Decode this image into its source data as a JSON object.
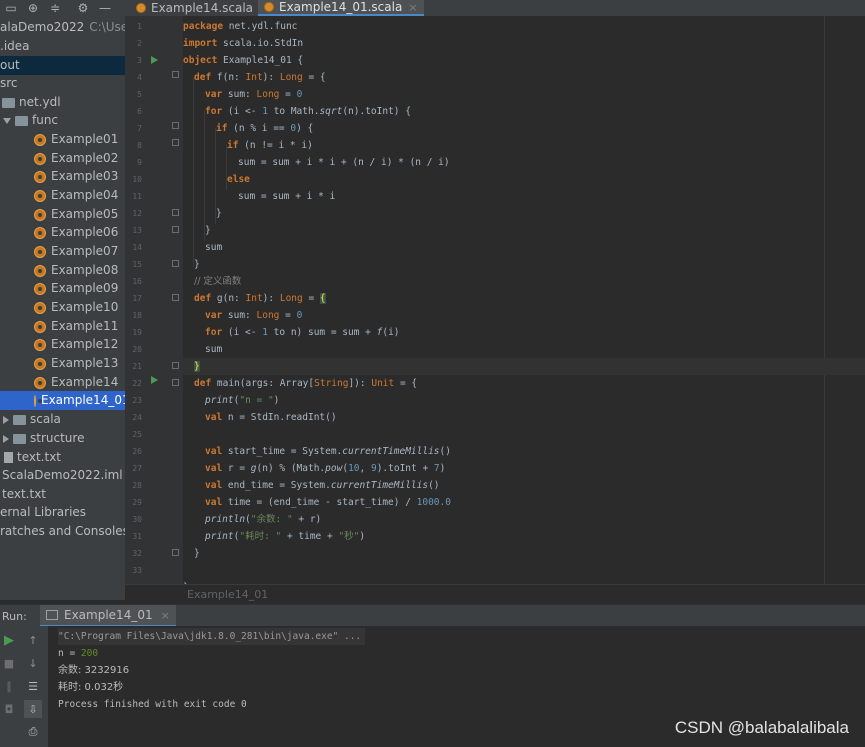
{
  "tabs": [
    {
      "label": "Example14.scala",
      "close": "×"
    },
    {
      "label": "Example14_01.scala",
      "close": "×"
    }
  ],
  "project_tree": [
    {
      "label": "alaDemo2022",
      "extra": "C:\\Users\\",
      "type": "folder-blue"
    },
    {
      "label": ".idea",
      "type": "folder"
    },
    {
      "label": "out",
      "type": "folder-orange",
      "selected": true
    },
    {
      "label": "src",
      "type": "folder-blue"
    },
    {
      "label": "net.ydl",
      "type": "folder"
    },
    {
      "label": "func",
      "type": "folder",
      "expanded": true
    },
    {
      "label": "Example01",
      "type": "scala"
    },
    {
      "label": "Example02",
      "type": "scala"
    },
    {
      "label": "Example03",
      "type": "scala"
    },
    {
      "label": "Example04",
      "type": "scala"
    },
    {
      "label": "Example05",
      "type": "scala"
    },
    {
      "label": "Example06",
      "type": "scala"
    },
    {
      "label": "Example07",
      "type": "scala"
    },
    {
      "label": "Example08",
      "type": "scala"
    },
    {
      "label": "Example09",
      "type": "scala"
    },
    {
      "label": "Example10",
      "type": "scala"
    },
    {
      "label": "Example11",
      "type": "scala"
    },
    {
      "label": "Example12",
      "type": "scala"
    },
    {
      "label": "Example13",
      "type": "scala"
    },
    {
      "label": "Example14",
      "type": "scala"
    },
    {
      "label": "Example14_01",
      "type": "scala",
      "active": true
    },
    {
      "label": "scala",
      "type": "folder"
    },
    {
      "label": "structure",
      "type": "folder"
    },
    {
      "label": "text.txt",
      "type": "file"
    },
    {
      "label": "ScalaDemo2022.iml",
      "type": "file"
    },
    {
      "label": "text.txt",
      "type": "file"
    },
    {
      "label": "ernal Libraries",
      "type": "lib"
    },
    {
      "label": "ratches and Consoles",
      "type": "lib"
    }
  ],
  "line_numbers": [
    "1",
    "2",
    "3",
    "4",
    "5",
    "6",
    "7",
    "8",
    "9",
    "10",
    "11",
    "12",
    "13",
    "14",
    "15",
    "16",
    "17",
    "18",
    "19",
    "20",
    "21",
    "22",
    "23",
    "24",
    "25",
    "26",
    "27",
    "28",
    "29",
    "30",
    "31",
    "32",
    "33"
  ],
  "code": {
    "l1": [
      "package",
      " net.ydl.func"
    ],
    "l2": [
      "import",
      " scala.io.StdIn"
    ],
    "l3": [
      "object",
      " Example14_01 {"
    ],
    "l4": [
      "def",
      " f(n: ",
      "Int",
      "): ",
      "Long",
      " = {"
    ],
    "l5": [
      "var",
      " sum: ",
      "Long",
      " = ",
      "0"
    ],
    "l6": [
      "for",
      " (i <- ",
      "1",
      " to Math.",
      "sqrt",
      "(n).toInt) {"
    ],
    "l7": [
      "if",
      " (n % i == ",
      "0",
      ") {"
    ],
    "l8": [
      "if",
      " (n != i * i)"
    ],
    "l9": "sum = sum + i * i + (n / i) * (n / i)",
    "l10": "else",
    "l11": "sum = sum + i * i",
    "l12": "}",
    "l13": "}",
    "l14": "sum",
    "l15": "}",
    "l16": "// 定义函数",
    "l17": [
      "def",
      " g(n: ",
      "Int",
      "): ",
      "Long",
      " = ",
      "{"
    ],
    "l18": [
      "var",
      " sum: ",
      "Long",
      " = ",
      "0"
    ],
    "l19": [
      "for",
      " (i <- ",
      "1",
      " to n) sum = sum + ",
      "f",
      "(i)"
    ],
    "l20": "sum",
    "l21": "}",
    "l22": [
      "def",
      " main(args: Array[",
      "String",
      "]): ",
      "Unit",
      " = {"
    ],
    "l23": [
      "print",
      "(",
      "\"n = \"",
      ")"
    ],
    "l24": [
      "val",
      " n = StdIn.",
      "readInt",
      "()"
    ],
    "l26": [
      "val",
      " start_time = System.",
      "currentTimeMillis",
      "()"
    ],
    "l27": [
      "val",
      " r = ",
      "g",
      "(n) % (Math.",
      "pow",
      "(",
      "10",
      ", ",
      "9",
      ").toInt + ",
      "7",
      ")"
    ],
    "l28": [
      "val",
      " end_time = System.",
      "currentTimeMillis",
      "()"
    ],
    "l29": [
      "val",
      " time = (end_time - start_time) / ",
      "1000.0"
    ],
    "l30": [
      "println",
      "(",
      "\"余数: \"",
      " + r)"
    ],
    "l31": [
      "print",
      "(",
      "\"耗时: \"",
      " + time + ",
      "\"秒\"",
      ")"
    ],
    "l32": "}",
    "l33": "}"
  },
  "breadcrumb": "Example14_01",
  "run_panel": {
    "label": "Run:",
    "tab": "Example14_01",
    "close": "×",
    "console": [
      "\"C:\\Program Files\\Java\\jdk1.8.0_281\\bin\\java.exe\" ...",
      "n = ",
      "200",
      "余数: 3232916",
      "耗时: 0.032秒",
      "Process finished with exit code 0"
    ]
  },
  "watermark": "CSDN @balabalalibala",
  "colors": {
    "keyword": "#cc7832",
    "number": "#6897bb",
    "string": "#6a8759",
    "comment": "#808080",
    "function": "#ffc66d",
    "background": "#2b2b2b"
  }
}
